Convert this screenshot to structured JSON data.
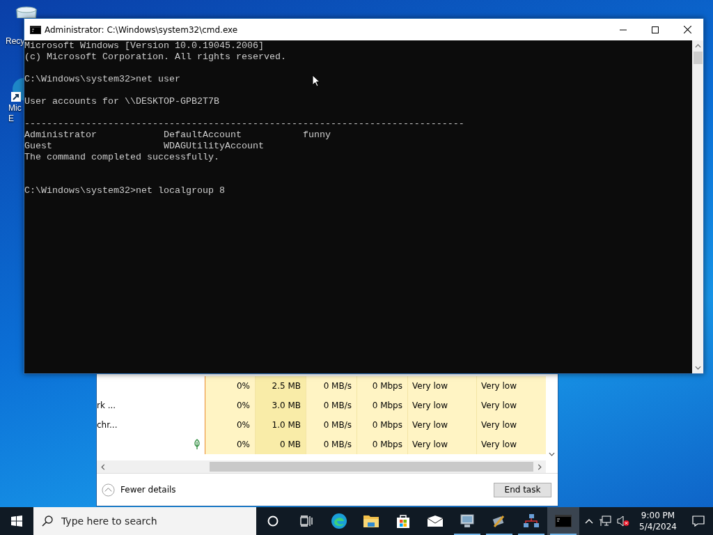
{
  "desktop_icons": [
    {
      "label_lines": [
        "Recy"
      ]
    },
    {
      "label_lines": [
        "Mic",
        "E"
      ]
    }
  ],
  "task_manager": {
    "rows": [
      {
        "name": "",
        "cpu": "0%",
        "memory": "2.5 MB",
        "disk": "0 MB/s",
        "network": "0 Mbps",
        "power": "Very low",
        "power_trend": "Very low",
        "leaf": false
      },
      {
        "name": "rk ...",
        "cpu": "0%",
        "memory": "3.0 MB",
        "disk": "0 MB/s",
        "network": "0 Mbps",
        "power": "Very low",
        "power_trend": "Very low",
        "leaf": false
      },
      {
        "name": "chr...",
        "cpu": "0%",
        "memory": "1.0 MB",
        "disk": "0 MB/s",
        "network": "0 Mbps",
        "power": "Very low",
        "power_trend": "Very low",
        "leaf": false
      },
      {
        "name": "",
        "cpu": "0%",
        "memory": "0 MB",
        "disk": "0 MB/s",
        "network": "0 Mbps",
        "power": "Very low",
        "power_trend": "Very low",
        "leaf": true
      }
    ],
    "fewer_details": "Fewer details",
    "end_task": "End task"
  },
  "cmd_window": {
    "title": "Administrator: C:\\Windows\\system32\\cmd.exe",
    "blocks": [
      [
        "Microsoft Windows [Version 10.0.19045.2006]",
        "(c) Microsoft Corporation. All rights reserved."
      ],
      [
        "C:\\Windows\\system32>net user"
      ],
      [
        "User accounts for \\\\DESKTOP-GPB2T7B"
      ],
      [
        "-------------------------------------------------------------------------------",
        "Administrator            DefaultAccount           funny",
        "Guest                    WDAGUtilityAccount",
        "The command completed successfully."
      ],
      [
        "C:\\Windows\\system32>net localgroup 8"
      ]
    ]
  },
  "taskbar": {
    "search": {
      "placeholder": "Type here to search"
    },
    "apps": [
      {
        "running": false,
        "selected": false
      },
      {
        "running": false,
        "selected": false
      },
      {
        "running": false,
        "selected": false
      },
      {
        "running": false,
        "selected": false
      },
      {
        "running": true,
        "selected": false
      },
      {
        "running": true,
        "selected": false
      },
      {
        "running": true,
        "selected": false
      },
      {
        "running": true,
        "selected": true
      }
    ],
    "time": "9:00 PM",
    "date": "5/4/2024"
  }
}
